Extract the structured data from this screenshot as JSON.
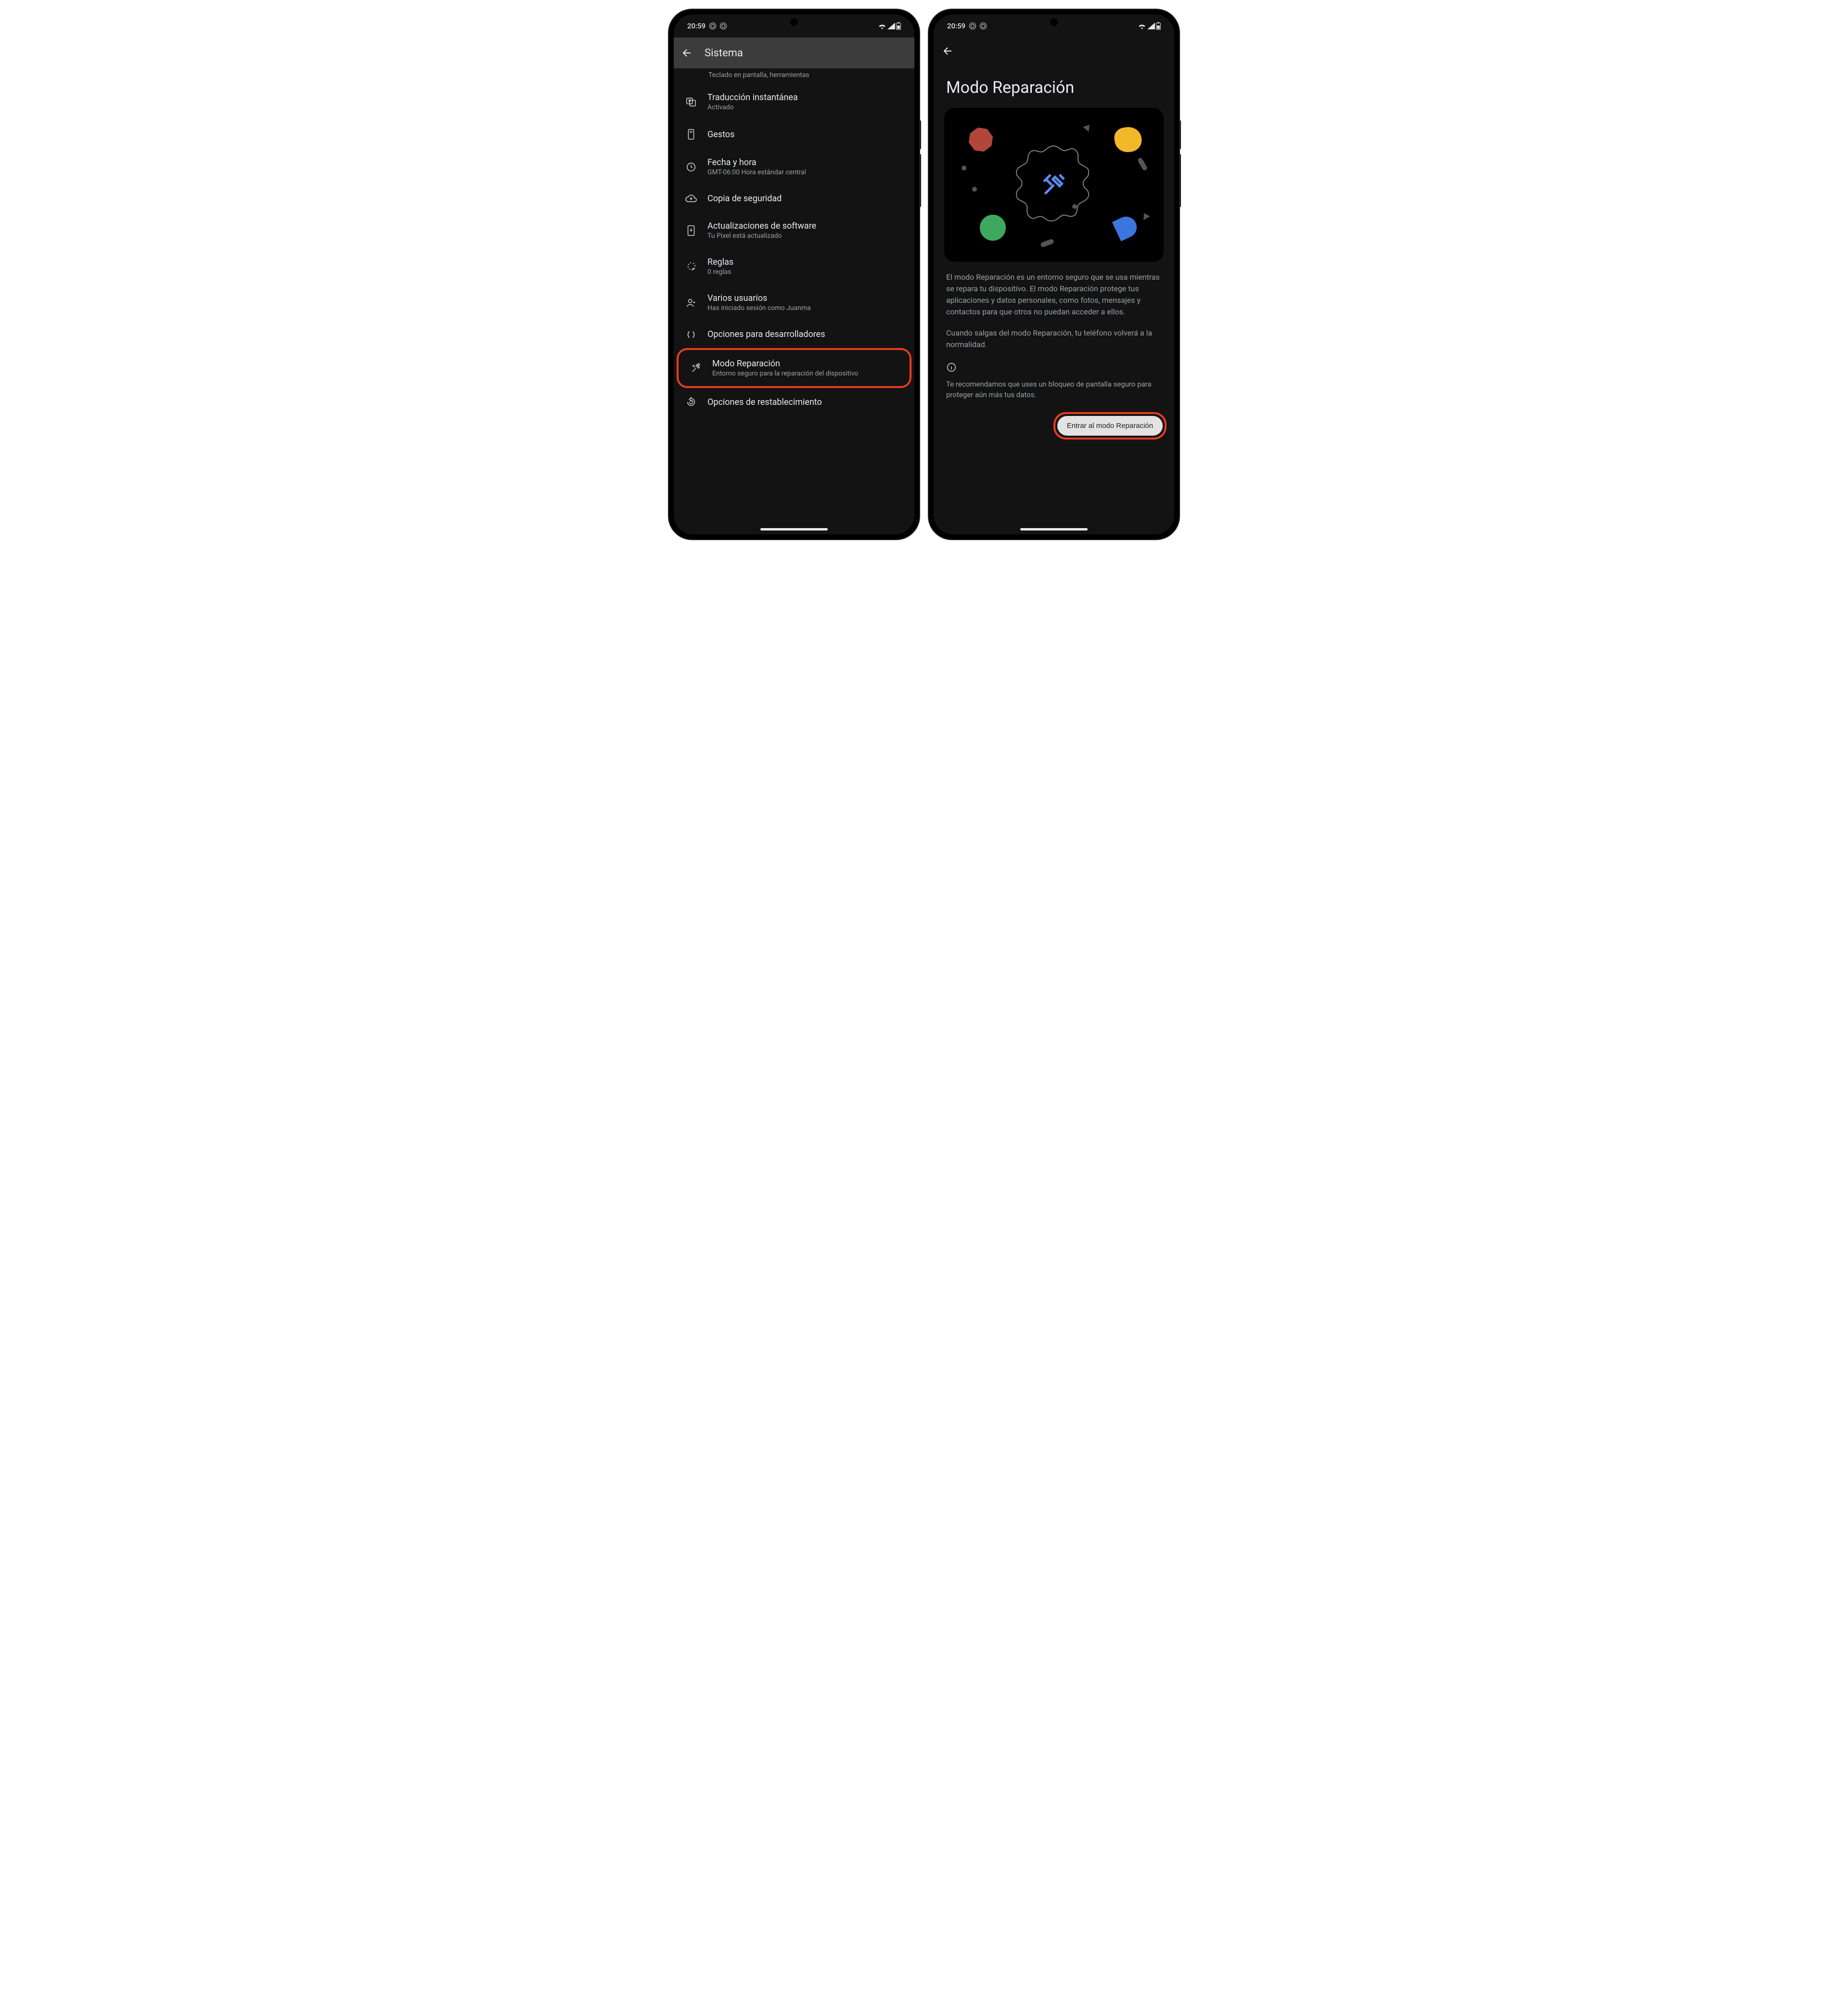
{
  "status": {
    "time": "20:59"
  },
  "screen1": {
    "appbar_title": "Sistema",
    "cutoff_text": "Teclado en pantalla, herramientas",
    "items": [
      {
        "primary": "Traducción instantánea",
        "secondary": "Activado",
        "icon": "translate"
      },
      {
        "primary": "Gestos",
        "secondary": "",
        "icon": "gesture"
      },
      {
        "primary": "Fecha y hora",
        "secondary": "GMT-06:00 Hora estándar central",
        "icon": "clock"
      },
      {
        "primary": "Copia de seguridad",
        "secondary": "",
        "icon": "backup"
      },
      {
        "primary": "Actualizaciones de software",
        "secondary": "Tu Pixel está actualizado",
        "icon": "update"
      },
      {
        "primary": "Reglas",
        "secondary": "0 reglas",
        "icon": "rules"
      },
      {
        "primary": "Varios usuarios",
        "secondary": "Has iniciado sesión como Juanma",
        "icon": "users"
      },
      {
        "primary": "Opciones para desarrolladores",
        "secondary": "",
        "icon": "dev"
      },
      {
        "primary": "Modo Reparación",
        "secondary": "Entorno seguro para la reparación del dispositivo",
        "icon": "repair",
        "highlight": true
      },
      {
        "primary": "Opciones de restablecimiento",
        "secondary": "",
        "icon": "reset"
      }
    ]
  },
  "screen2": {
    "title": "Modo Reparación",
    "para1": "El modo Reparación es un entorno seguro que se usa mientras se repara tu dispositivo. El mo­do Reparación protege tus aplicaciones y datos personales, como fotos, mensajes y contactos para que otros no puedan acceder a ellos.",
    "para2": "Cuando salgas del modo Reparación, tu teléfono volverá a la normalidad.",
    "recommend": "Te recomendamos que uses un bloqueo de pantalla seguro para proteger aún más tus datos.",
    "button": "Entrar al modo Reparación"
  }
}
